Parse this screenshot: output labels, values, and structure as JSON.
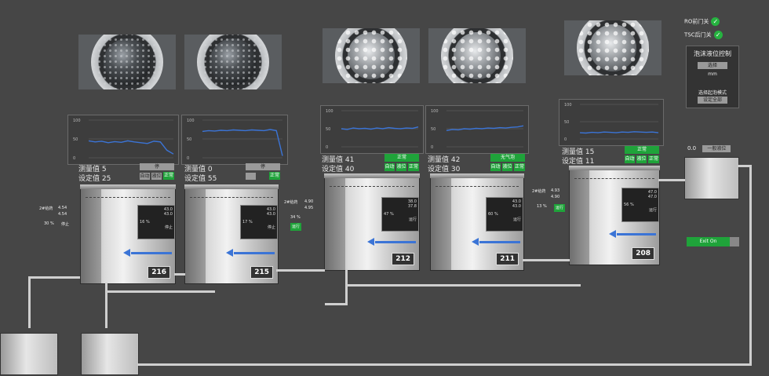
{
  "status": {
    "items": [
      {
        "label": "RO前门关",
        "state": "ok"
      },
      {
        "label": "TSC后门关",
        "state": "ok"
      }
    ]
  },
  "foam_panel": {
    "title": "泡沫液位控制",
    "select_label": "选择",
    "unit_value": "mm",
    "mode_label": "选择起泡模式",
    "set_all_label": "设定全部"
  },
  "tanks": [
    {
      "id": "216",
      "measured_label": "测量值",
      "measured_value": "5",
      "set_label": "设定值",
      "set_value": "25",
      "mode_btn": "停",
      "auto_btn": "自动",
      "status1": "液位",
      "status2": "正常",
      "chart_y_ticks": [
        "100",
        "50",
        "0"
      ],
      "ctrl_top": "43.0",
      "ctrl_mid": "43.0",
      "ctrl_pct": "16 %",
      "ctrl_sub": "停止"
    },
    {
      "id": "215",
      "measured_label": "测量值",
      "measured_value": "0",
      "set_label": "设定值",
      "set_value": "55",
      "mode_btn": "停",
      "auto_btn": "",
      "status1": "",
      "status2": "正常",
      "chart_y_ticks": [
        "100",
        "50",
        "0"
      ],
      "ctrl_top": "43.0",
      "ctrl_mid": "43.0",
      "ctrl_pct": "17 %",
      "ctrl_sub": "停止"
    },
    {
      "id": "212",
      "measured_label": "测量值",
      "measured_value": "41",
      "set_label": "设定值",
      "set_value": "40",
      "mode_btn": "正常",
      "auto_btn": "自动",
      "status1": "液位",
      "status2": "正常",
      "chart_y_ticks": [
        "100",
        "50",
        "0"
      ],
      "ctrl_top": "38.0",
      "ctrl_mid": "37.8",
      "ctrl_pct": "47 %",
      "ctrl_sub": "运行"
    },
    {
      "id": "211",
      "measured_label": "测量值",
      "measured_value": "42",
      "set_label": "设定值",
      "set_value": "30",
      "mode_btn": "无气泡",
      "auto_btn": "自动",
      "status1": "液位",
      "status2": "正常",
      "chart_y_ticks": [
        "100",
        "50",
        "0"
      ],
      "ctrl_top": "43.0",
      "ctrl_mid": "43.0",
      "ctrl_pct": "60 %",
      "ctrl_sub": "运行"
    },
    {
      "id": "208",
      "measured_label": "测量值",
      "measured_value": "15",
      "set_label": "设定值",
      "set_value": "11",
      "mode_btn": "正常",
      "auto_btn": "自动",
      "status1": "液位",
      "status2": "正常",
      "chart_y_ticks": [
        "100",
        "50",
        "0"
      ],
      "ctrl_top": "47.0",
      "ctrl_mid": "47.0",
      "ctrl_pct": "56 %",
      "ctrl_sub": "运行"
    }
  ],
  "side_valves": [
    {
      "label": "2#给药",
      "v1": "4.54",
      "v2": "4.54",
      "pct": "30 %",
      "tag": "停止"
    },
    {
      "label": "2#给药",
      "v1": "4.90",
      "v2": "4.95",
      "pct": "34 %",
      "tag": "运行"
    },
    {
      "label": "2#给药",
      "v1": "4.93",
      "v2": "4.90",
      "pct": "13 %",
      "tag": "运行"
    }
  ],
  "right_box": {
    "value": "0.0",
    "label": "一般液位"
  },
  "exit_toggle": {
    "label": "Exit On"
  },
  "colors": {
    "accent_green": "#1fa33a",
    "line_blue": "#3b74d6",
    "background": "#464646"
  }
}
